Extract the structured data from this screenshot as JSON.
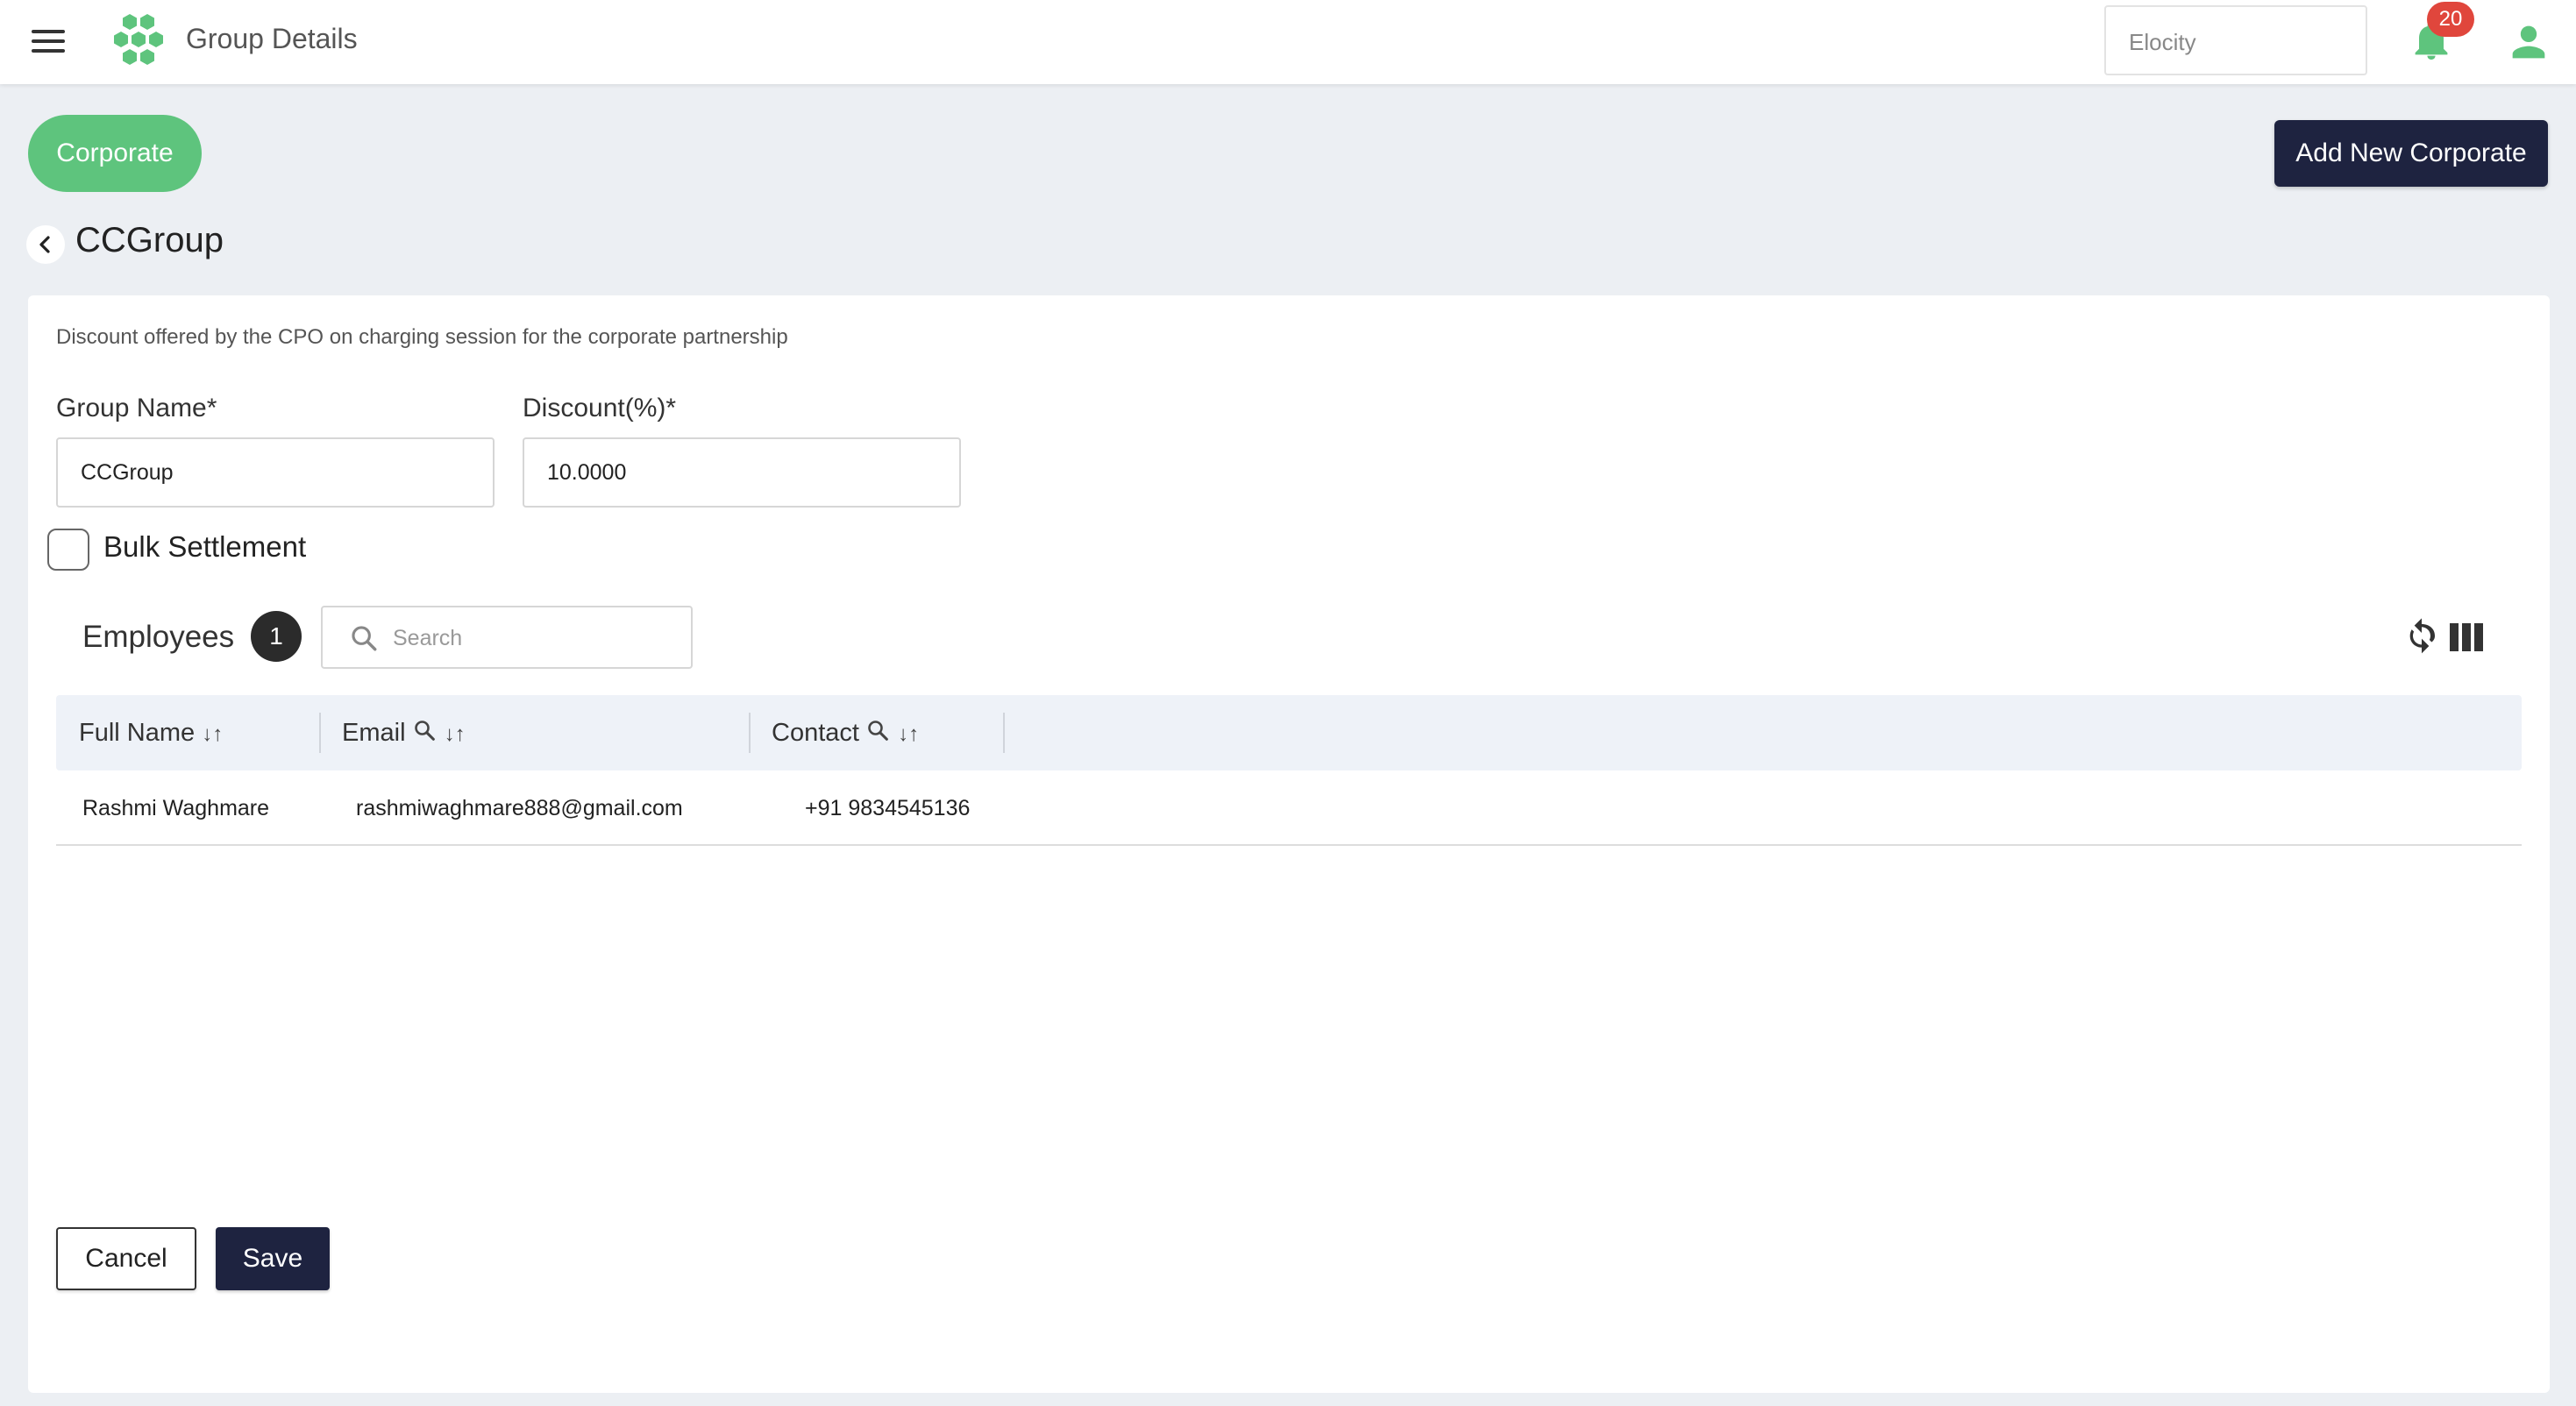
{
  "header": {
    "title": "Group Details",
    "org_selector": "Elocity",
    "notification_count": "20",
    "brand_color": "#5ec47d"
  },
  "toolbar": {
    "corporate_pill": "Corporate",
    "add_new_corporate": "Add New Corporate"
  },
  "page": {
    "title": "CCGroup"
  },
  "form": {
    "description": "Discount offered by the CPO on charging session for the corporate partnership",
    "group_name_label": "Group Name*",
    "group_name_value": "CCGroup",
    "discount_label": "Discount(%)*",
    "discount_value": "10.0000",
    "bulk_settlement_label": "Bulk Settlement",
    "bulk_settlement_checked": false
  },
  "employees": {
    "title": "Employees",
    "count": "1",
    "search_placeholder": "Search",
    "columns": [
      "Full Name",
      "Email",
      "Contact"
    ],
    "rows": [
      {
        "full_name": "Rashmi Waghmare",
        "email": "rashmiwaghmare888@gmail.com",
        "contact": "+91 9834545136"
      }
    ]
  },
  "actions": {
    "cancel": "Cancel",
    "save": "Save"
  },
  "colors": {
    "primary_dark": "#1e2340",
    "success_green": "#5ec47d",
    "badge_red": "#e0463c"
  }
}
